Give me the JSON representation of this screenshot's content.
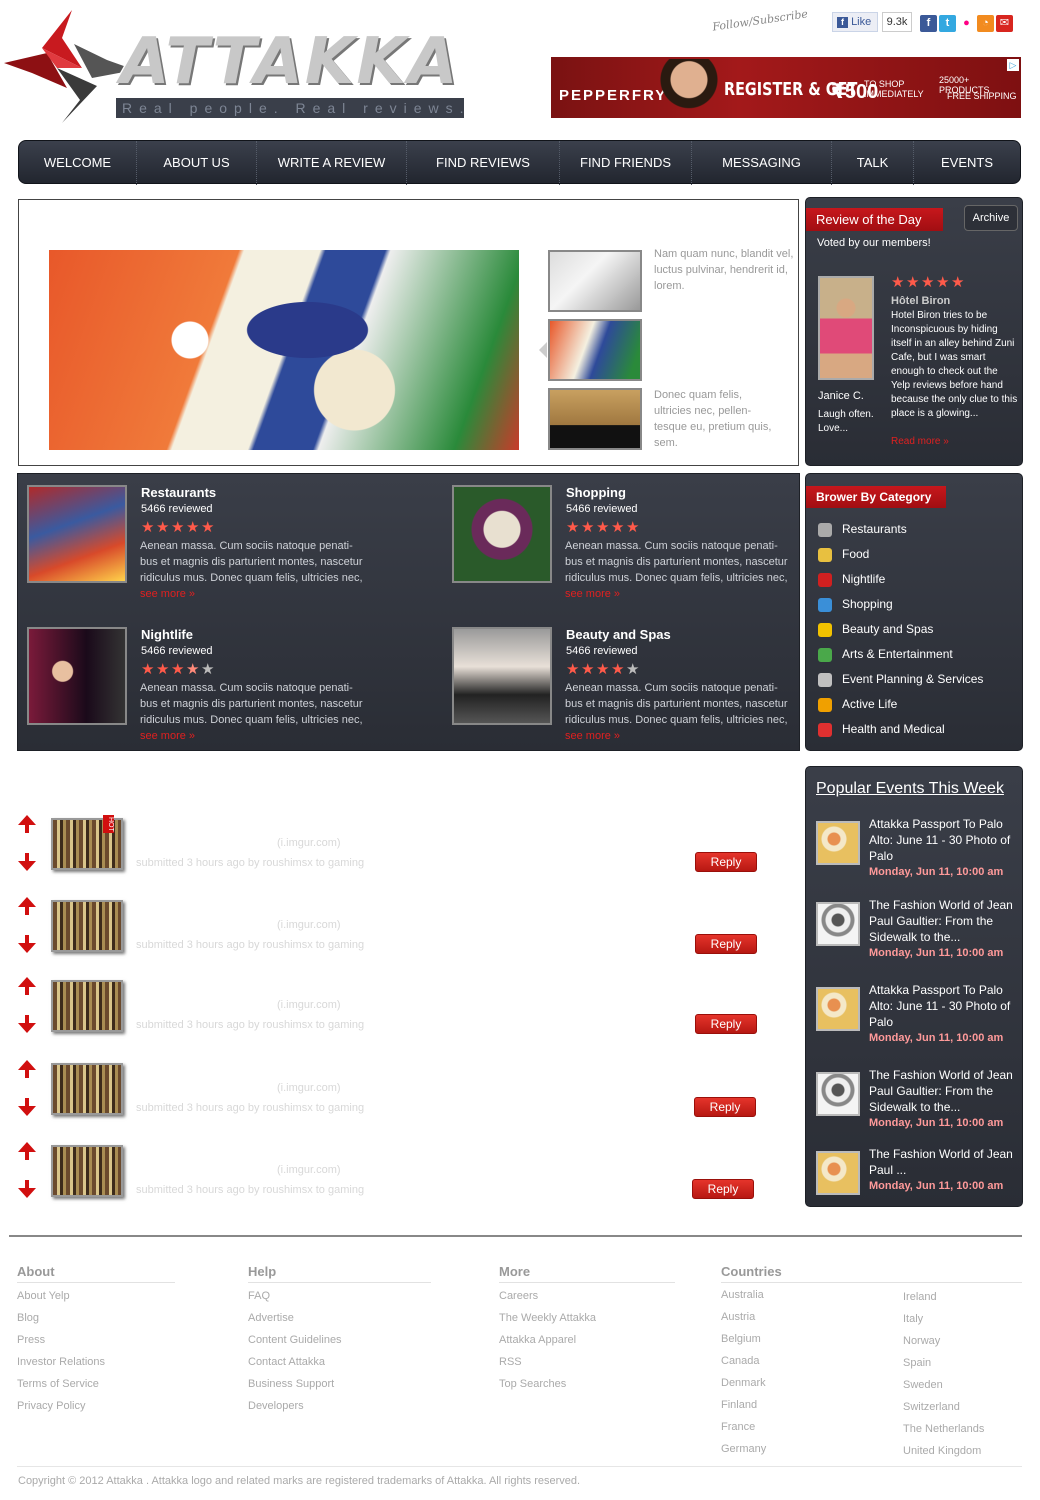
{
  "header": {
    "logo_text": "ATTAKKA",
    "tagline": "Real people. Real reviews.",
    "follow_label": "Follow/Subscribe",
    "like_label": "Like",
    "like_count": "9.3k"
  },
  "ad": {
    "brand": "PEPPERFRY",
    "headline_1": "REGISTER & GET",
    "headline_2": "₹500",
    "headline_3": "TO SHOP IMMEDIATELY",
    "side_1": "25000+ PRODUCTS",
    "side_2": "FREE SHIPPING"
  },
  "nav": [
    "WELCOME",
    "ABOUT US",
    "WRITE A REVIEW",
    "FIND REVIEWS",
    "FIND FRIENDS",
    "MESSAGING",
    "TALK",
    "EVENTS"
  ],
  "slider": {
    "caption_top": "Nam quam nunc, blandit vel, luctus pulvinar, hendrerit id, lorem.",
    "caption_bottom": "Donec quam felis, ultricies nec, pellen-tesque eu, pretium quis, sem."
  },
  "review_of_day": {
    "title": "Review of the Day",
    "archive": "Archive",
    "subtitle": "Voted by our members!",
    "reviewer": "Janice C.",
    "reviewer_note": "Laugh often. Love...",
    "place": "Hôtel Biron",
    "text": "Hotel Biron tries to be Inconspicuous by hiding itself in an alley behind Zuni Cafe, but I was smart enough to check out the Yelp reviews before hand because the only clue to this place is a glowing...",
    "read_more": "Read more »",
    "rating": 5
  },
  "categories": [
    {
      "title": "Restaurants",
      "count": "5466 reviewed",
      "rating": 5,
      "text": "Aenean massa. Cum sociis natoque penati-bus et magnis dis parturient montes, nascetur ridiculus mus. Donec quam felis, ultricies nec,",
      "more": "see more »"
    },
    {
      "title": "Shopping",
      "count": "5466 reviewed",
      "rating": 5,
      "text": "Aenean massa. Cum sociis natoque penati-bus et magnis dis parturient montes, nascetur ridiculus mus. Donec quam felis, ultricies nec,",
      "more": "see more »"
    },
    {
      "title": "Nightlife",
      "count": "5466 reviewed",
      "rating": 3.5,
      "text": "Aenean massa. Cum sociis natoque penati-bus et magnis dis parturient montes, nascetur ridiculus mus. Donec quam felis, ultricies nec,",
      "more": "see more »"
    },
    {
      "title": "Beauty and Spas",
      "count": "5466 reviewed",
      "rating": 4,
      "text": "Aenean massa. Cum sociis natoque penati-bus et magnis dis parturient montes, nascetur ridiculus mus. Donec quam felis, ultricies nec,",
      "more": "see more »"
    }
  ],
  "browse": {
    "title": "Brower By Category",
    "items": [
      {
        "label": "Restaurants",
        "icon": "fork-icon",
        "color": "#aaaaaa"
      },
      {
        "label": "Food",
        "icon": "food-icon",
        "color": "#e8c040"
      },
      {
        "label": "Nightlife",
        "icon": "wine-glass-icon",
        "color": "#d02020"
      },
      {
        "label": "Shopping",
        "icon": "shopping-bag-icon",
        "color": "#3a8fd8"
      },
      {
        "label": "Beauty and Spas",
        "icon": "smiley-icon",
        "color": "#f2c200"
      },
      {
        "label": "Arts & Entertainment",
        "icon": "ticket-icon",
        "color": "#4aa84a"
      },
      {
        "label": "Event Planning & Services",
        "icon": "party-hat-icon",
        "color": "#c0c0c0"
      },
      {
        "label": "Active Life",
        "icon": "runner-icon",
        "color": "#f0a000"
      },
      {
        "label": "Health and Medical",
        "icon": "first-aid-icon",
        "color": "#e03030"
      }
    ]
  },
  "events": {
    "title": "Popular Events This Week",
    "items": [
      {
        "title": "Attakka Passport To Palo Alto: June 11 - 30 Photo of Palo",
        "date": "Monday, Jun 11, 10:00 am"
      },
      {
        "title": "The Fashion World of Jean Paul Gaultier: From the Sidewalk to the...",
        "date": "Monday, Jun 11, 10:00 am"
      },
      {
        "title": "Attakka Passport To Palo Alto: June 11 - 30 Photo of Palo",
        "date": "Monday, Jun 11, 10:00 am"
      },
      {
        "title": "The Fashion World of Jean Paul Gaultier: From the Sidewalk to the...",
        "date": "Monday, Jun 11, 10:00 am"
      },
      {
        "title": "The Fashion World of Jean Paul ...",
        "date": "Monday, Jun 11, 10:00 am"
      }
    ]
  },
  "posts": [
    {
      "domain": "(i.imgur.com)",
      "meta": "submitted 3 hours ago by roushimsx to gaming",
      "reply": "Reply",
      "hot": "HOT"
    },
    {
      "domain": "(i.imgur.com)",
      "meta": "submitted 3 hours ago by roushimsx to gaming",
      "reply": "Reply"
    },
    {
      "domain": "(i.imgur.com)",
      "meta": "submitted 3 hours ago by roushimsx to gaming",
      "reply": "Reply"
    },
    {
      "domain": "(i.imgur.com)",
      "meta": "submitted 3 hours ago by roushimsx to gaming",
      "reply": "Reply"
    },
    {
      "domain": "(i.imgur.com)",
      "meta": "submitted 3 hours ago by roushimsx to gaming",
      "reply": "Reply"
    }
  ],
  "footer": {
    "about": {
      "title": "About",
      "links": [
        "About Yelp",
        "Blog",
        "Press",
        "Investor Relations",
        "Terms of Service",
        "Privacy Policy"
      ]
    },
    "help": {
      "title": "Help",
      "links": [
        "FAQ",
        "Advertise",
        "Content Guidelines",
        "Contact Attakka",
        "Business Support",
        "Developers"
      ]
    },
    "more": {
      "title": "More",
      "links": [
        "Careers",
        "The Weekly Attakka",
        "Attakka Apparel",
        "RSS",
        "Top Searches"
      ]
    },
    "countries": {
      "title": "Countries",
      "col1": [
        "Australia",
        "Austria",
        "Belgium",
        "Canada",
        "Denmark",
        "Finland",
        "France",
        "Germany"
      ],
      "col2": [
        "Ireland",
        "Italy",
        "Norway",
        "Spain",
        "Sweden",
        "Switzerland",
        "The Netherlands",
        "United Kingdom"
      ]
    },
    "copyright": "Copyright © 2012 Attakka . Attakka logo and related marks are registered trademarks of Attakka. All rights reserved."
  }
}
